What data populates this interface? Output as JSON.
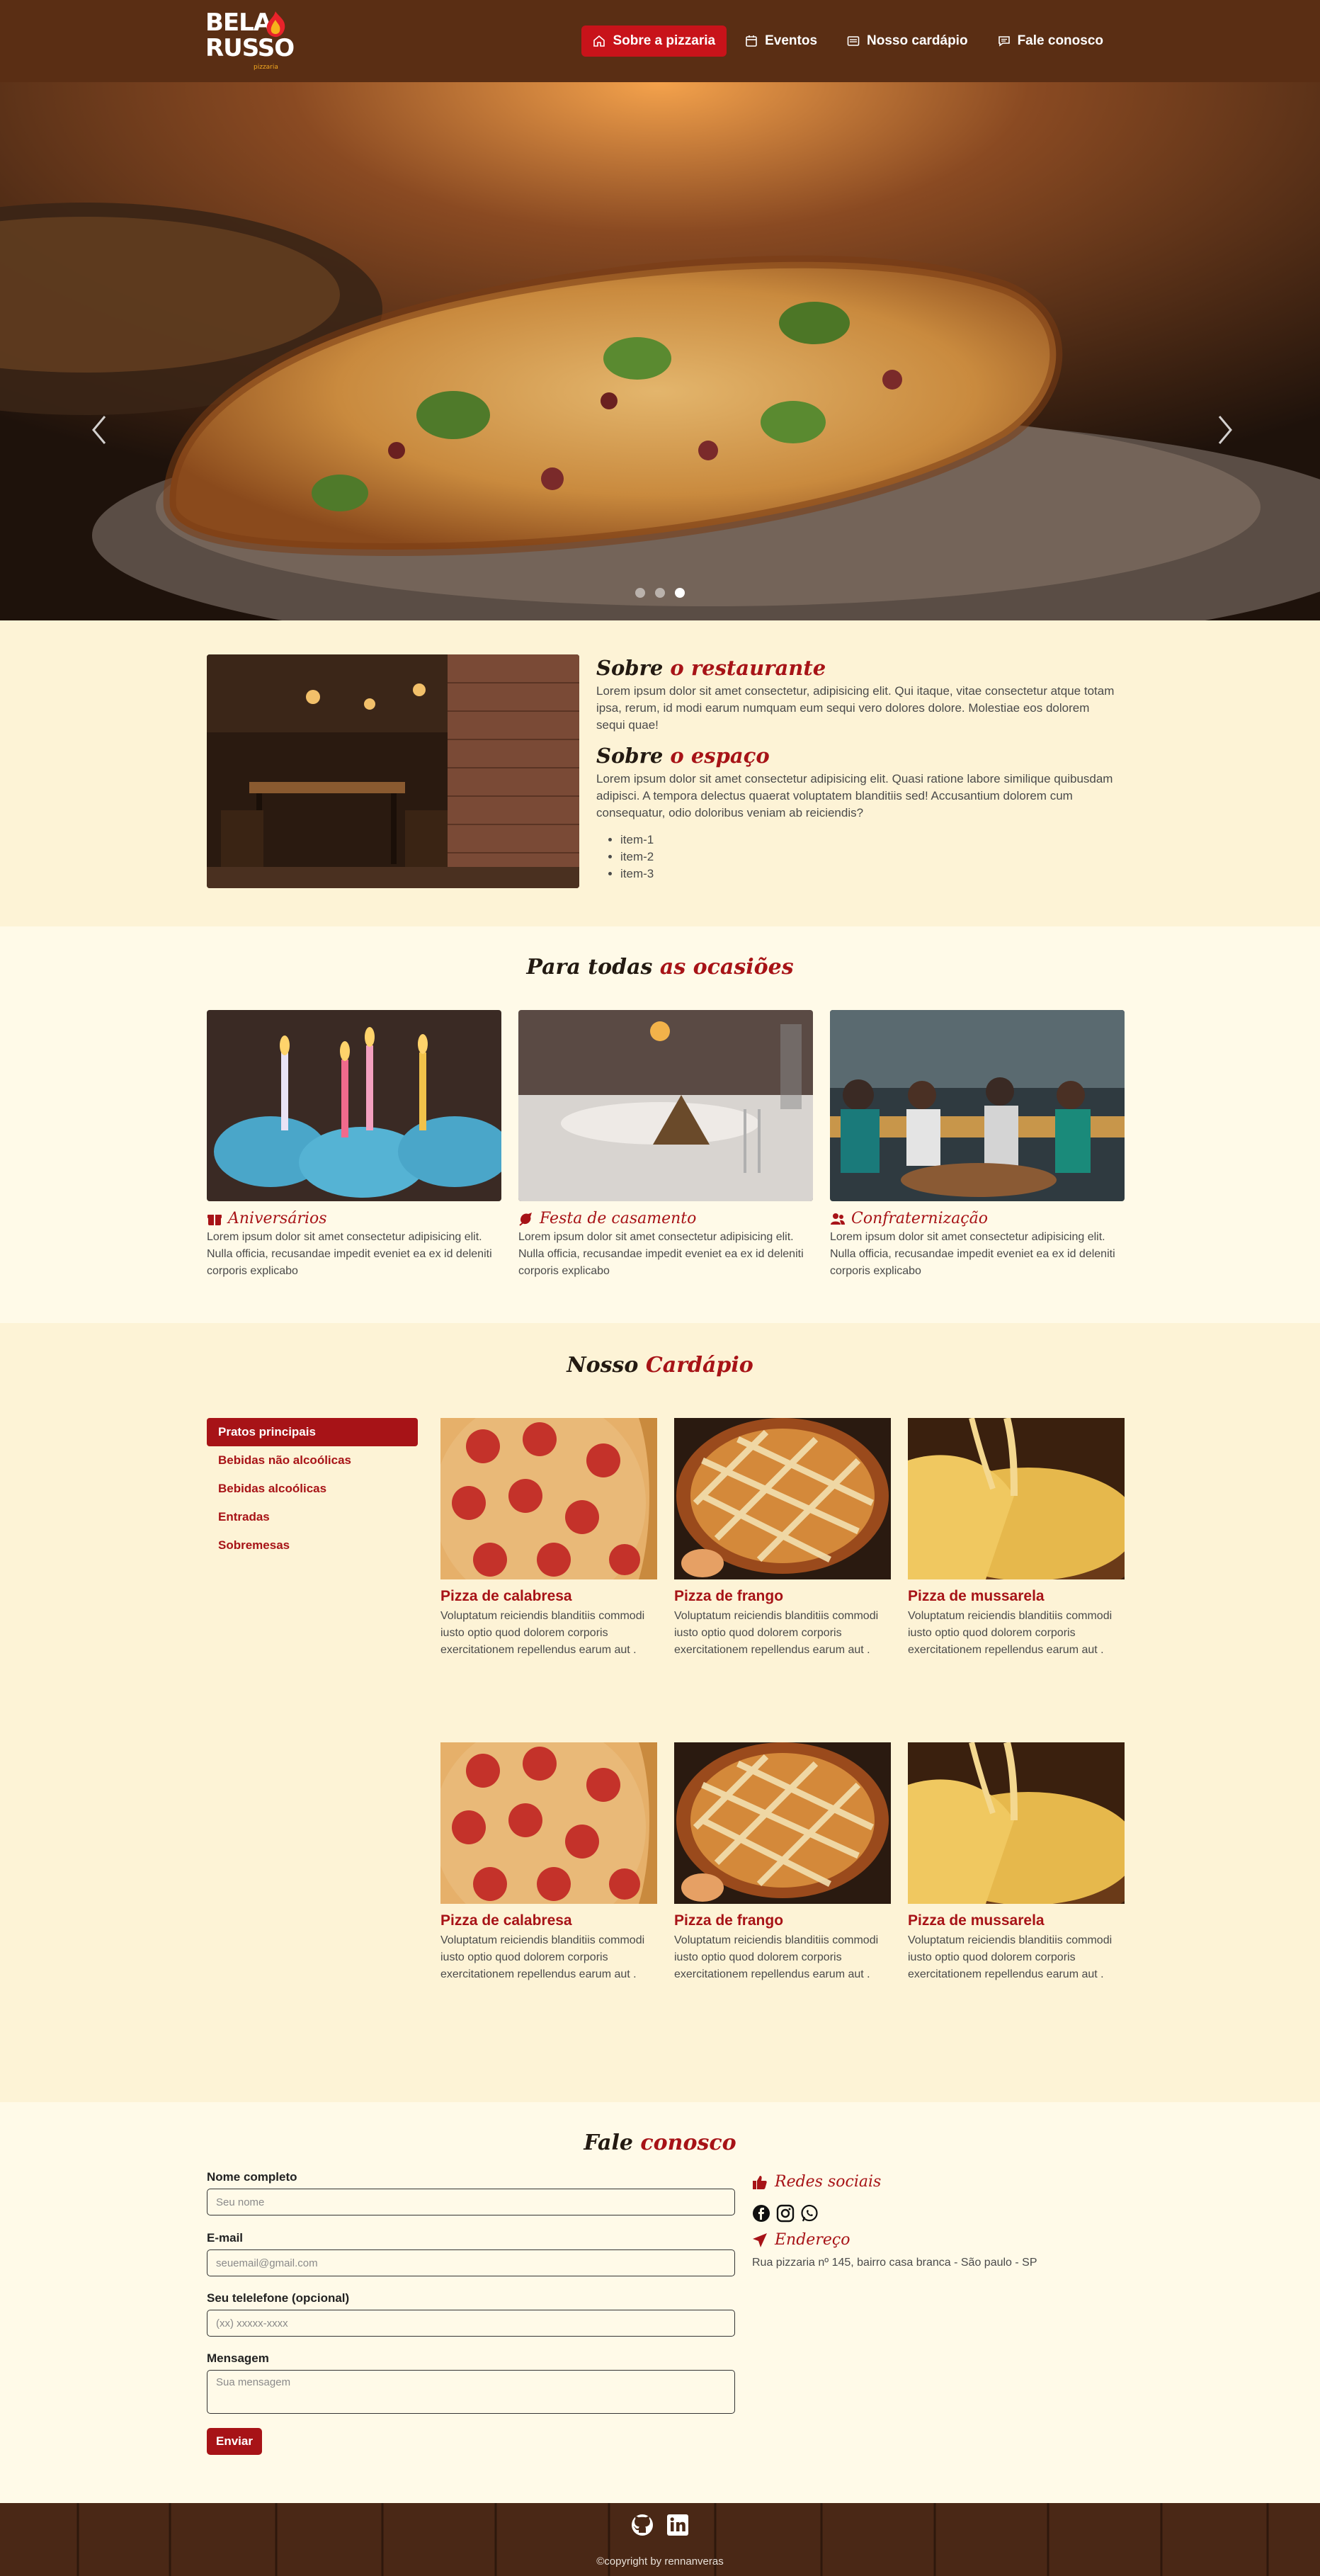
{
  "brand": {
    "line1": "BELA",
    "line2": "RUSSO",
    "sub": "pizzaria"
  },
  "nav": {
    "items": [
      {
        "label": "Sobre a pizzaria",
        "icon": "home-icon"
      },
      {
        "label": "Eventos",
        "icon": "calendar-icon"
      },
      {
        "label": "Nosso cardápio",
        "icon": "list-icon"
      },
      {
        "label": "Fale conosco",
        "icon": "chat-icon"
      }
    ]
  },
  "carousel": {
    "slide_count": 3,
    "active_index": 2
  },
  "sobre": {
    "title1_plain": "Sobre",
    "title1_accent": "o restaurante",
    "text1": "Lorem ipsum dolor sit amet consectetur, adipisicing elit. Qui itaque, vitae consectetur atque totam ipsa, rerum, id modi earum numquam eum sequi vero dolores dolore. Molestiae eos dolorem sequi quae!",
    "title2_plain": "Sobre",
    "title2_accent": "o espaço",
    "text2": "Lorem ipsum dolor sit amet consectetur adipisicing elit. Quasi ratione labore similique quibusdam adipisci. A tempora delectus quaerat voluptatem blanditiis sed! Accusantium dolorem cum consequatur, odio doloribus veniam ab reiciendis?",
    "items": [
      "item-1",
      "item-2",
      "item-3"
    ]
  },
  "ocasioes": {
    "title_plain": "Para todas",
    "title_accent": "as ocasiões",
    "cards": [
      {
        "title": "Aniversários",
        "icon": "gift-icon",
        "text": "Lorem ipsum dolor sit amet consectetur adipisicing elit. Nulla officia, recusandae impedit eveniet ea ex id deleniti corporis explicabo"
      },
      {
        "title": "Festa de casamento",
        "icon": "ring-icon",
        "text": "Lorem ipsum dolor sit amet consectetur adipisicing elit. Nulla officia, recusandae impedit eveniet ea ex id deleniti corporis explicabo"
      },
      {
        "title": "Confraternização",
        "icon": "users-icon",
        "text": "Lorem ipsum dolor sit amet consectetur adipisicing elit. Nulla officia, recusandae impedit eveniet ea ex id deleniti corporis explicabo"
      }
    ]
  },
  "cardapio": {
    "title_plain": "Nosso",
    "title_accent": "Cardápio",
    "categories": [
      "Pratos principais",
      "Bebidas não alcoólicas",
      "Bebidas alcoólicas",
      "Entradas",
      "Sobremesas"
    ],
    "dishes": [
      {
        "name": "Pizza de calabresa",
        "desc": "Voluptatum reiciendis blanditiis commodi iusto optio quod dolorem corporis exercitationem repellendus earum aut ."
      },
      {
        "name": "Pizza de frango",
        "desc": "Voluptatum reiciendis blanditiis commodi iusto optio quod dolorem corporis exercitationem repellendus earum aut ."
      },
      {
        "name": "Pizza de mussarela",
        "desc": "Voluptatum reiciendis blanditiis commodi iusto optio quod dolorem corporis exercitationem repellendus earum aut ."
      },
      {
        "name": "Pizza de calabresa",
        "desc": "Voluptatum reiciendis blanditiis commodi iusto optio quod dolorem corporis exercitationem repellendus earum aut ."
      },
      {
        "name": "Pizza de frango",
        "desc": "Voluptatum reiciendis blanditiis commodi iusto optio quod dolorem corporis exercitationem repellendus earum aut ."
      },
      {
        "name": "Pizza de mussarela",
        "desc": "Voluptatum reiciendis blanditiis commodi iusto optio quod dolorem corporis exercitationem repellendus earum aut ."
      }
    ]
  },
  "fale": {
    "title_plain": "Fale",
    "title_accent": "conosco",
    "fields": [
      {
        "label": "Nome completo",
        "placeholder": "Seu nome",
        "value": ""
      },
      {
        "label": "E-mail",
        "placeholder": "seuemail@gmail.com",
        "value": ""
      },
      {
        "label": "Seu telelefone (opcional)",
        "placeholder": "(xx) xxxxx-xxxx",
        "value": ""
      },
      {
        "label": "Mensagem",
        "placeholder": "Sua mensagem",
        "value": ""
      }
    ],
    "submit_label": "Enviar",
    "social_title": "Redes sociais",
    "social_icons": [
      "facebook-icon",
      "instagram-icon",
      "whatsapp-icon"
    ],
    "address_title": "Endereço",
    "address": "Rua pizzaria nº 145, bairro casa branca - São paulo - SP"
  },
  "footer": {
    "icons": [
      "github-icon",
      "linkedin-icon"
    ],
    "copyright": "©copyright by rennanveras"
  },
  "colors": {
    "header_brown": "#5a2e14",
    "accent_red": "#a71317",
    "nav_active": "#c8131a",
    "cream": "#fdf3d6",
    "cream_light": "#fffae8"
  }
}
